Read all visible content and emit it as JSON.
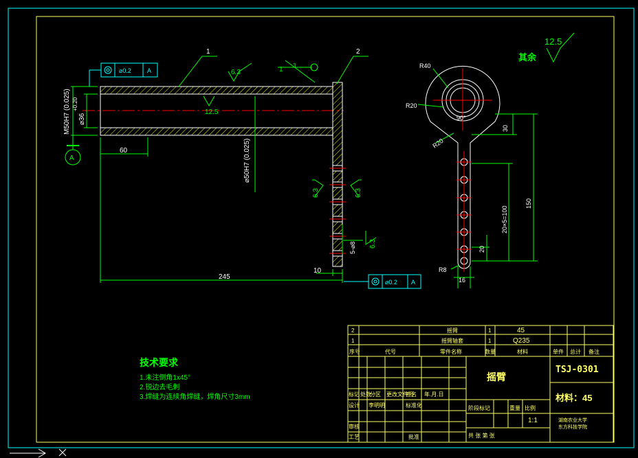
{
  "colors": {
    "background": "#000000",
    "frame": "#00ffff",
    "part": "#ffffff",
    "dimension": "#00ff00",
    "roughness": "#00ff00",
    "hatch": "#ffff00",
    "center_line": "#ff0000",
    "title_block": "#ffff66",
    "notes": "#00ff00"
  },
  "balloons": {
    "part1": "1",
    "part2": "2",
    "datum": "A",
    "weld_ref": "1",
    "weld_num": "3"
  },
  "tolerance_frames": {
    "top": {
      "sym": "◎",
      "value": "⌀0.2",
      "datum": "A"
    },
    "bottom": {
      "sym": "◎",
      "value": "⌀0.2",
      "datum": "A"
    }
  },
  "dimensions": {
    "m50": "M50H7 (0.025)",
    "d36": "⌀36",
    "d36_tol": "+0.20",
    "d50": "⌀50H7 (0.025)",
    "len60": "60",
    "len245": "245",
    "len10": "10",
    "weld_side": "5-⌀8",
    "r40": "R40",
    "r20a": "R20",
    "r20b": "R20",
    "angle": "90°",
    "v30": "30",
    "v150": "150",
    "v100": "20×5=100",
    "v20": "20",
    "r8": "R8",
    "w16": "16"
  },
  "roughness": {
    "main": "12.5",
    "r1": "6.3",
    "r2": "6.3",
    "r3": "6.3",
    "r4": "6.3",
    "r5": "6.3",
    "other": "12.5",
    "other_label": "其余"
  },
  "notes": {
    "title": "技术要求",
    "items": [
      "1.未注倒角1x45°",
      "2.锐边去毛刺",
      "3.焊缝为连续角焊缝，焊角尺寸3mm"
    ]
  },
  "title_block": {
    "bom": [
      {
        "no": "2",
        "name": "摇臂",
        "qty": "1",
        "mat": "45"
      },
      {
        "no": "1",
        "name": "摇臂轴套",
        "qty": "1",
        "mat": "Q235"
      }
    ],
    "header": [
      "序号",
      "代号",
      "零件名称",
      "数量",
      "材料",
      "单件",
      "总计",
      "备注"
    ],
    "part_name": "摇臂",
    "drawing_no": "TSJ-0301",
    "material": "材料：45",
    "scale": "1:1",
    "school": "湖南农业大学",
    "school2": "东方科技学院",
    "labels": {
      "mark": "标记",
      "count": "处数",
      "zone": "分区",
      "change": "更改文件号",
      "sign": "签名",
      "date": "年.月.日",
      "design": "设计",
      "std": "标准化",
      "stage": "阶段标记",
      "weight": "重量",
      "ratio": "比例",
      "check": "审核",
      "craft": "工艺",
      "approve": "批准",
      "sheets": "共  张 第  张",
      "designer": "李明明"
    }
  }
}
